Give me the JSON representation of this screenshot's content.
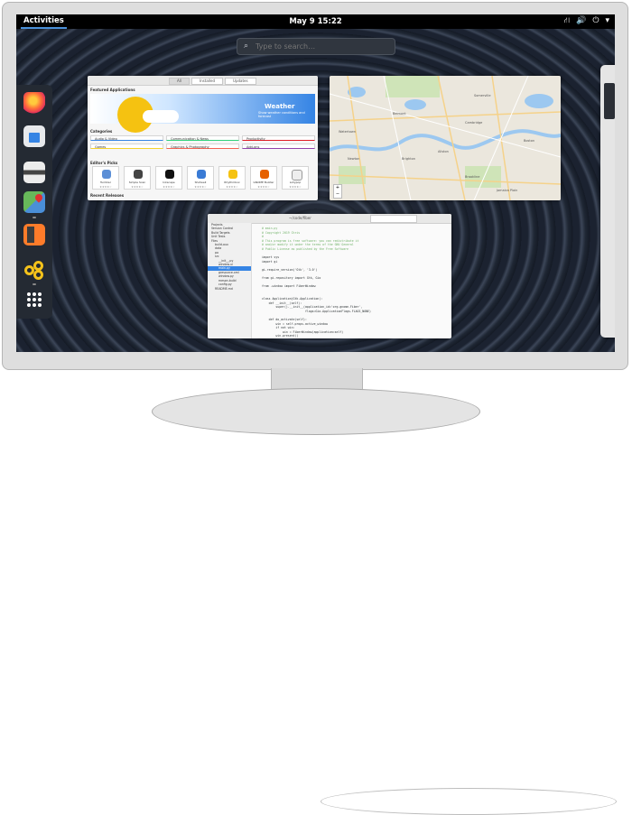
{
  "topbar": {
    "activities_label": "Activities",
    "clock": "May 9  15:22",
    "tray_icons": [
      "network-icon",
      "volume-icon",
      "power-icon",
      "chevron-down-icon"
    ]
  },
  "search": {
    "placeholder": "Type to search…"
  },
  "dock": {
    "apps": [
      "firefox-icon",
      "software-icon",
      "disks-icon",
      "maps-icon",
      "calculator-icon",
      "builder-icon",
      "app-grid-icon"
    ]
  },
  "software_window": {
    "tabs": [
      "All",
      "Installed",
      "Updates"
    ],
    "featured_heading": "Featured Applications",
    "banner_title": "Weather",
    "banner_desc": "Show weather conditions and forecast",
    "categories_heading": "Categories",
    "categories": [
      "Audio & Video",
      "Communication & News",
      "Productivity",
      "Games",
      "Graphics & Photography",
      "Add-ons"
    ],
    "category_colors": [
      "#3584e4",
      "#33d17a",
      "#e01b24",
      "#f6d32d",
      "#f66151",
      "#9141ac"
    ],
    "editors_heading": "Editor's Picks",
    "picks": [
      "Tumbler",
      "Simple Scan",
      "Inkscape",
      "Shotwell",
      "Rhythmbox",
      "GNOME Builder",
      "Lollypop"
    ],
    "pick_ratings": "★★★★☆",
    "recent_heading": "Recent Releases"
  },
  "map_window": {
    "labels": [
      "Watertown",
      "Belmont",
      "Cambridge",
      "Somerville",
      "Brighton",
      "Allston",
      "Boston",
      "Brookline",
      "Newton",
      "Jamaica Plain"
    ],
    "controls": [
      "+",
      "−"
    ]
  },
  "editor_window": {
    "path": "~/code/fiber",
    "tree": [
      "Projects",
      "Version Control",
      "Build Targets",
      "Unit Tests",
      "Files",
      "build-aux",
      "data",
      "po",
      "src",
      "__init__.py",
      "window.ui",
      "main.py",
      "gresource.xml",
      "window.py",
      "meson.build",
      "config.py",
      "README.md"
    ],
    "code_lines": [
      "# main.py",
      "# Copyright 2019 Chris",
      "#",
      "# This program is free software: you can redistribute it",
      "# and/or modify it under the terms of the GNU General",
      "# Public License as published by the Free Software",
      "",
      "import sys",
      "import gi",
      "",
      "gi.require_version('Gtk', '3.0')",
      "",
      "from gi.repository import Gtk, Gio",
      "",
      "from .window import FiberWindow",
      "",
      "",
      "class Application(Gtk.Application):",
      "    def __init__(self):",
      "        super().__init__(application_id='org.gnome.Fiber',",
      "                         flags=Gio.ApplicationFlags.FLAGS_NONE)",
      "",
      "    def do_activate(self):",
      "        win = self.props.active_window",
      "        if not win:",
      "            win = FiberWindow(application=self)",
      "        win.present()",
      "",
      "",
      "def main(version):",
      "    app = Application()",
      "    return app.run(sys.argv)"
    ]
  }
}
